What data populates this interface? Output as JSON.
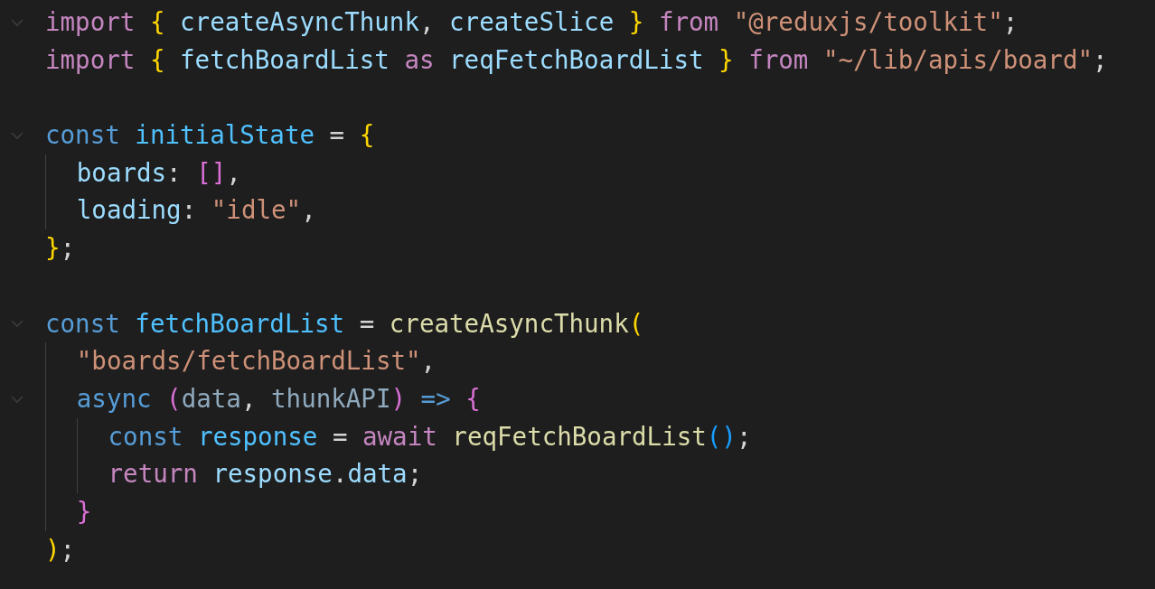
{
  "editor": {
    "lines": [
      {
        "kind": "code",
        "foldable": true,
        "tokens": [
          {
            "kind": "keyword",
            "text": "import "
          },
          {
            "kind": "bracket1",
            "text": "{ "
          },
          {
            "kind": "variable",
            "text": "createAsyncThunk"
          },
          {
            "kind": "punct",
            "text": ", "
          },
          {
            "kind": "variable",
            "text": "createSlice "
          },
          {
            "kind": "bracket1",
            "text": "} "
          },
          {
            "kind": "keyword",
            "text": "from "
          },
          {
            "kind": "string",
            "text": "\"@reduxjs/toolkit\""
          },
          {
            "kind": "punct",
            "text": ";"
          }
        ]
      },
      {
        "kind": "code",
        "foldable": false,
        "tokens": [
          {
            "kind": "keyword",
            "text": "import "
          },
          {
            "kind": "bracket1",
            "text": "{ "
          },
          {
            "kind": "variable",
            "text": "fetchBoardList "
          },
          {
            "kind": "keyword",
            "text": "as "
          },
          {
            "kind": "variable",
            "text": "reqFetchBoardList "
          },
          {
            "kind": "bracket1",
            "text": "} "
          },
          {
            "kind": "keyword",
            "text": "from "
          },
          {
            "kind": "string",
            "text": "\"~/lib/apis/board\""
          },
          {
            "kind": "punct",
            "text": ";"
          }
        ]
      },
      {
        "kind": "blank",
        "foldable": false
      },
      {
        "kind": "code",
        "foldable": true,
        "tokens": [
          {
            "kind": "storage",
            "text": "const "
          },
          {
            "kind": "constant",
            "text": "initialState"
          },
          {
            "kind": "punct",
            "text": " = "
          },
          {
            "kind": "bracket1",
            "text": "{"
          }
        ],
        "children": [
          {
            "kind": "code",
            "foldable": false,
            "tokens": [
              {
                "kind": "variable",
                "text": "boards"
              },
              {
                "kind": "punct",
                "text": ": "
              },
              {
                "kind": "bracket2",
                "text": "[]"
              },
              {
                "kind": "punct",
                "text": ","
              }
            ]
          },
          {
            "kind": "code",
            "foldable": false,
            "tokens": [
              {
                "kind": "variable",
                "text": "loading"
              },
              {
                "kind": "punct",
                "text": ": "
              },
              {
                "kind": "string",
                "text": "\"idle\""
              },
              {
                "kind": "punct",
                "text": ","
              }
            ]
          }
        ]
      },
      {
        "kind": "code",
        "foldable": false,
        "tokens": [
          {
            "kind": "bracket1",
            "text": "}"
          },
          {
            "kind": "punct",
            "text": ";"
          }
        ]
      },
      {
        "kind": "blank",
        "foldable": false
      },
      {
        "kind": "code",
        "foldable": true,
        "tokens": [
          {
            "kind": "storage",
            "text": "const "
          },
          {
            "kind": "constant",
            "text": "fetchBoardList"
          },
          {
            "kind": "punct",
            "text": " = "
          },
          {
            "kind": "function",
            "text": "createAsyncThunk"
          },
          {
            "kind": "bracket1",
            "text": "("
          }
        ],
        "children": [
          {
            "kind": "code",
            "foldable": false,
            "tokens": [
              {
                "kind": "string",
                "text": "\"boards/fetchBoardList\""
              },
              {
                "kind": "punct",
                "text": ","
              }
            ]
          },
          {
            "kind": "code",
            "foldable": true,
            "tokens": [
              {
                "kind": "storage",
                "text": "async "
              },
              {
                "kind": "bracket2",
                "text": "("
              },
              {
                "kind": "param",
                "text": "data"
              },
              {
                "kind": "punct",
                "text": ", "
              },
              {
                "kind": "param",
                "text": "thunkAPI"
              },
              {
                "kind": "bracket2",
                "text": ") "
              },
              {
                "kind": "storage",
                "text": "=> "
              },
              {
                "kind": "bracket2",
                "text": "{"
              }
            ],
            "children": [
              {
                "kind": "code",
                "foldable": false,
                "tokens": [
                  {
                    "kind": "storage",
                    "text": "const "
                  },
                  {
                    "kind": "constant",
                    "text": "response"
                  },
                  {
                    "kind": "punct",
                    "text": " = "
                  },
                  {
                    "kind": "keyword",
                    "text": "await "
                  },
                  {
                    "kind": "function",
                    "text": "reqFetchBoardList"
                  },
                  {
                    "kind": "bracket3",
                    "text": "()"
                  },
                  {
                    "kind": "punct",
                    "text": ";"
                  }
                ]
              },
              {
                "kind": "code",
                "foldable": false,
                "tokens": [
                  {
                    "kind": "keyword",
                    "text": "return "
                  },
                  {
                    "kind": "variable",
                    "text": "response"
                  },
                  {
                    "kind": "punct",
                    "text": "."
                  },
                  {
                    "kind": "variable",
                    "text": "data"
                  },
                  {
                    "kind": "punct",
                    "text": ";"
                  }
                ]
              }
            ]
          },
          {
            "kind": "code",
            "foldable": false,
            "tokens": [
              {
                "kind": "bracket2",
                "text": "}"
              }
            ]
          }
        ]
      },
      {
        "kind": "code",
        "foldable": false,
        "tokens": [
          {
            "kind": "bracket1",
            "text": ")"
          },
          {
            "kind": "punct",
            "text": ";"
          }
        ]
      }
    ]
  }
}
